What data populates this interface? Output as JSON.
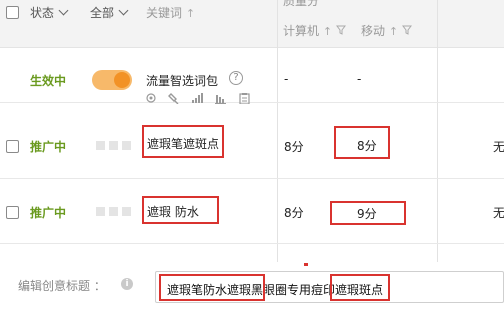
{
  "table": {
    "header": {
      "top_group": "质量分",
      "status_filter": "状态",
      "scope_filter": "全部",
      "keyword_col": "关键词",
      "sort_arrow": "↑",
      "computer_col": "计算机",
      "mobile_col": "移动",
      "overflow_col": ""
    },
    "rows": [
      {
        "status": "生效中",
        "keyword": "流量智选词包",
        "help_glyph": "?",
        "computer": "-",
        "mobile": "-",
        "overflow": "",
        "icons": [
          "gear-icon",
          "wrench-icon",
          "signal-bars-icon",
          "bar-chart-icon",
          "clipboard-icon"
        ]
      },
      {
        "status": "推广中",
        "keyword": "遮瑕笔遮斑点",
        "computer": "8分",
        "mobile": "8分",
        "overflow": "无"
      },
      {
        "status": "推广中",
        "keyword": "遮瑕 防水",
        "computer": "8分",
        "mobile": "9分",
        "overflow": "无"
      }
    ]
  },
  "creative": {
    "label": "编辑创意标题 ：",
    "info_glyph": "i",
    "title_value": "遮瑕笔防水遮瑕黑眼圈专用痘印遮瑕斑点"
  },
  "colors": {
    "status_green": "#6a9a1f",
    "toggle_on": "#f29226",
    "highlight_red": "#d9332f",
    "header_bg": "#f3f3f3"
  }
}
